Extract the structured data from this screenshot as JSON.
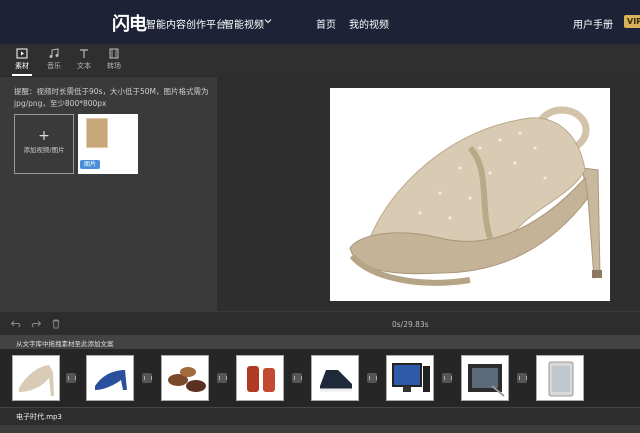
{
  "header": {
    "logo": "闪电",
    "brand": "智能内容创作平台",
    "dropdown_label": "智能视频",
    "nav_home": "首页",
    "nav_my_videos": "我的视频",
    "user_manual": "用户手册",
    "vip_badge": "VIP",
    "icon_chevron": "chevron-down-icon"
  },
  "toolbar": {
    "tools": [
      {
        "label": "素材",
        "icon": "media-icon",
        "active": true
      },
      {
        "label": "音乐",
        "icon": "music-note-icon"
      },
      {
        "label": "文本",
        "icon": "text-icon"
      },
      {
        "label": "转场",
        "icon": "transition-icon"
      }
    ]
  },
  "material_panel": {
    "hint": "提醒：视频时长需低于90s，大小低于50M，图片格式需为jpg/png，至少800*800px",
    "add_tile_label": "添加视频/图片",
    "thumb_badge": "图片"
  },
  "timeline": {
    "time_readout": "0s/29.83s",
    "icons": [
      "undo-icon",
      "redo-icon",
      "trash-icon"
    ],
    "text_track_hint": "从文字库中拖拽素材至此添加文案",
    "clips": [
      {
        "name": "clip-sandal",
        "color": "#d9cbb5"
      },
      {
        "name": "clip-blue-heels",
        "color": "#2a4f9c"
      },
      {
        "name": "clip-kids-shoes",
        "color": "#7a4a2a"
      },
      {
        "name": "clip-red-boots",
        "color": "#b03a24"
      },
      {
        "name": "clip-sneaker",
        "color": "#1e2a3a"
      },
      {
        "name": "clip-monitor",
        "color": "#2f5aa8"
      },
      {
        "name": "clip-tablet-pen",
        "color": "#5a6a7a"
      },
      {
        "name": "clip-tablet",
        "color": "#bfc7cf"
      }
    ],
    "audio_label": "电子时代.mp3"
  },
  "colors": {
    "header_bg": "#1e2236",
    "panel_bg": "#3a3a3a",
    "accent_badge": "#4a90d9",
    "vip": "#d8b25a"
  }
}
